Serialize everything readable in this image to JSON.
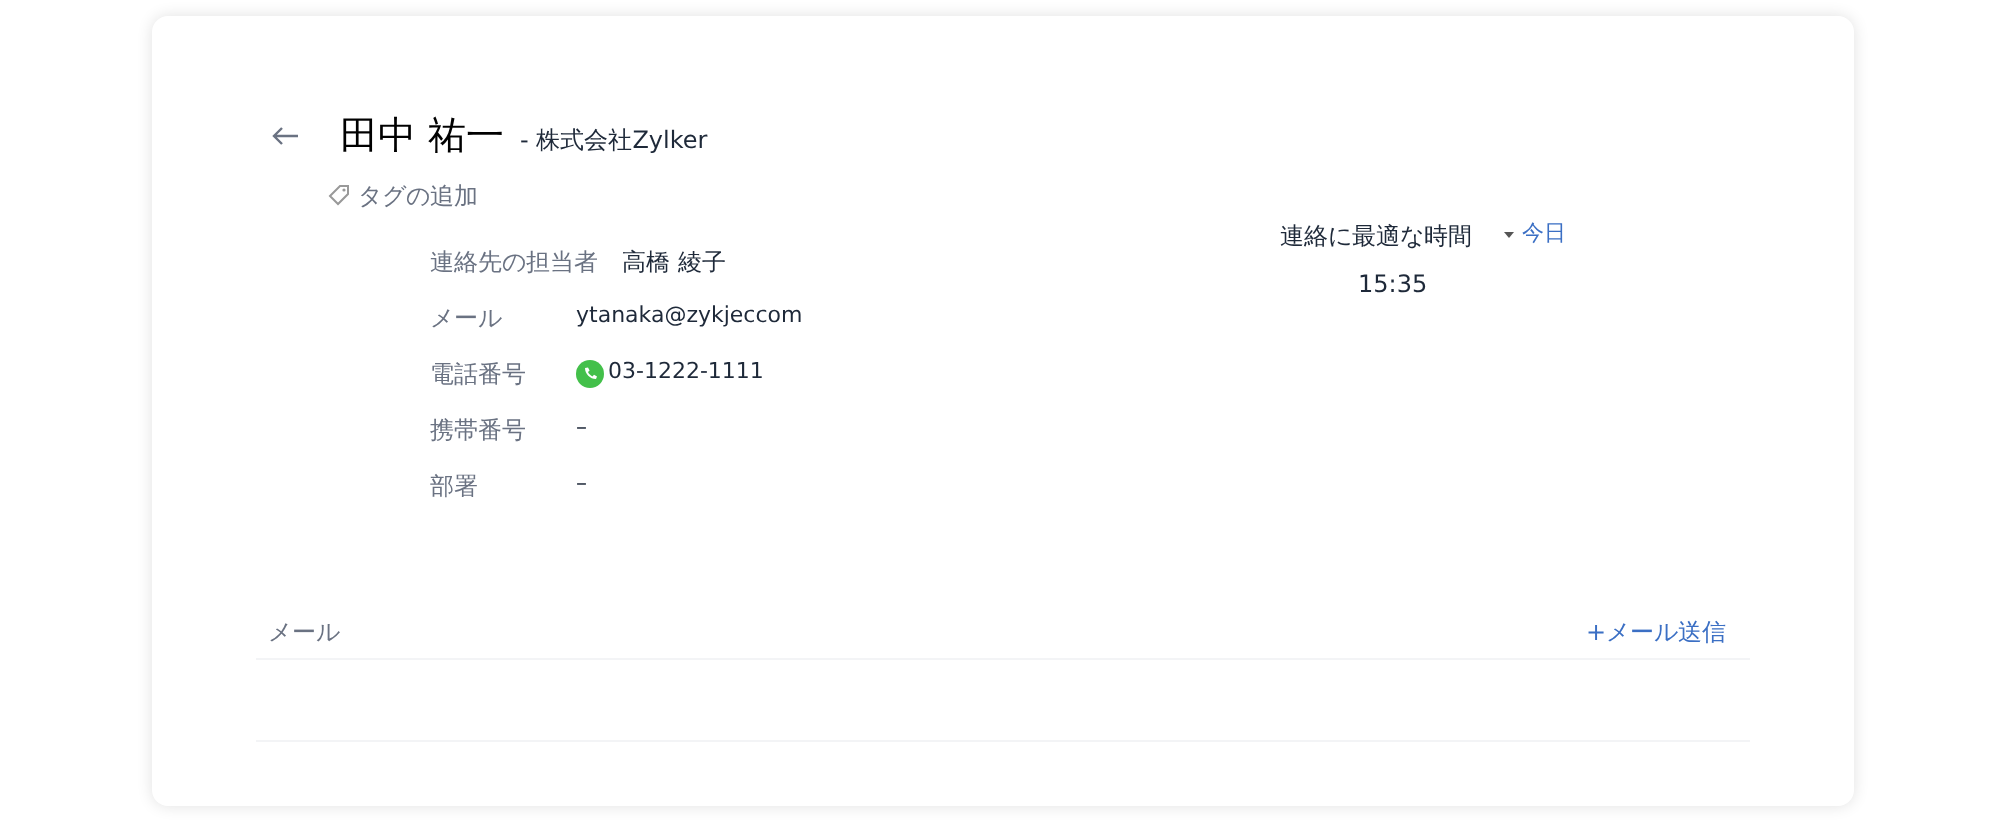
{
  "contact": {
    "name": "田中 祐一",
    "company": "- 株式会社Zylker",
    "tag_link": "タグの追加"
  },
  "owner": {
    "label": "連絡先の担当者",
    "value": "高橋 綾子"
  },
  "fields": [
    {
      "kind": "text",
      "label": "メール",
      "value": "ytanaka@zykjeccom"
    },
    {
      "kind": "phone",
      "label": "電話番号",
      "value": "03-1222-1111"
    },
    {
      "kind": "text",
      "label": "携帯番号",
      "value": "–"
    },
    {
      "kind": "text",
      "label": "部署",
      "value": "–"
    }
  ],
  "best_time": {
    "label": "連絡に最適な時間",
    "day": "今日",
    "time": "15:35"
  },
  "email_section": {
    "title": "メール",
    "action": "+メール送信"
  }
}
